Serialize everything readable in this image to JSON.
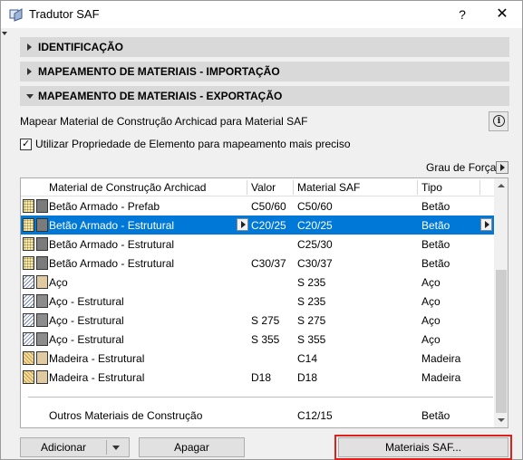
{
  "window": {
    "title": "Tradutor SAF",
    "help": "?",
    "close": "✕"
  },
  "sections": [
    {
      "label": "IDENTIFICAÇÃO",
      "expanded": false
    },
    {
      "label": "MAPEAMENTO DE MATERIAIS - IMPORTAÇÃO",
      "expanded": false
    },
    {
      "label": "MAPEAMENTO DE MATERIAIS - EXPORTAÇÃO",
      "expanded": true
    }
  ],
  "export": {
    "description": "Mapear Material de Construção Archicad para Material SAF",
    "info_icon": "i",
    "checkbox_label": "Utilizar Propriedade de Elemento para mapeamento mais preciso",
    "checkbox_checked": true,
    "checkbox_mark": "✓",
    "grau_label": "Grau de Força"
  },
  "table": {
    "columns": [
      "Material de Construção Archicad",
      "Valor",
      "Material SAF",
      "Tipo"
    ],
    "rows": [
      {
        "name": "Betão Armado - Prefab",
        "valor": "C50/60",
        "saf": "C50/60",
        "tipo": "Betão",
        "pattern": "dots",
        "color": "dark",
        "selected": false
      },
      {
        "name": "Betão Armado - Estrutural",
        "valor": "C20/25",
        "saf": "C20/25",
        "tipo": "Betão",
        "pattern": "dots",
        "color": "dark",
        "selected": true
      },
      {
        "name": "Betão Armado - Estrutural",
        "valor": "",
        "saf": "C25/30",
        "tipo": "Betão",
        "pattern": "dots",
        "color": "dark",
        "selected": false
      },
      {
        "name": "Betão Armado - Estrutural",
        "valor": "C30/37",
        "saf": "C30/37",
        "tipo": "Betão",
        "pattern": "dots",
        "color": "dark",
        "selected": false
      },
      {
        "name": "Aço",
        "valor": "",
        "saf": "S 235",
        "tipo": "Aço",
        "pattern": "hatch",
        "color": "wood",
        "selected": false
      },
      {
        "name": "Aço - Estrutural",
        "valor": "",
        "saf": "S 235",
        "tipo": "Aço",
        "pattern": "hatch",
        "color": "steel",
        "selected": false
      },
      {
        "name": "Aço - Estrutural",
        "valor": "S 275",
        "saf": "S 275",
        "tipo": "Aço",
        "pattern": "hatch",
        "color": "steel",
        "selected": false
      },
      {
        "name": "Aço - Estrutural",
        "valor": "S 355",
        "saf": "S 355",
        "tipo": "Aço",
        "pattern": "hatch",
        "color": "steel",
        "selected": false
      },
      {
        "name": "Madeira - Estrutural",
        "valor": "",
        "saf": "C14",
        "tipo": "Madeira",
        "pattern": "wood",
        "color": "wood",
        "selected": false
      },
      {
        "name": "Madeira - Estrutural",
        "valor": "D18",
        "saf": "D18",
        "tipo": "Madeira",
        "pattern": "wood",
        "color": "wood",
        "selected": false
      }
    ],
    "other_row": {
      "name": "Outros Materiais de Construção",
      "saf": "C12/15",
      "tipo": "Betão"
    }
  },
  "buttons": {
    "adicionar": "Adicionar",
    "apagar": "Apagar",
    "materiais": "Materiais SAF..."
  },
  "colors": {
    "selection": "#0078d7",
    "highlight": "#e0211b",
    "section_bg": "#d9d9d9"
  }
}
